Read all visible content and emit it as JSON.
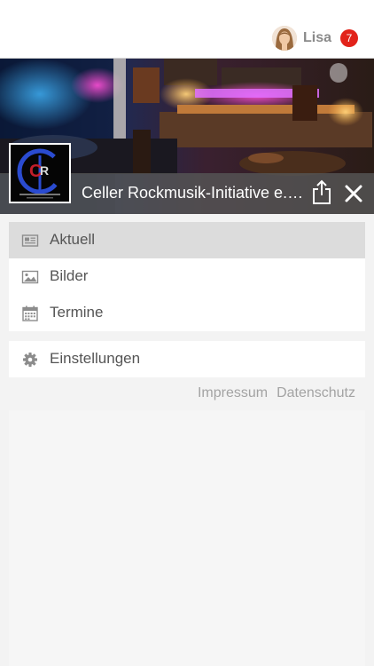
{
  "user": {
    "name": "Lisa",
    "notification_count": "7"
  },
  "header": {
    "title": "Celler Rockmusik-Initiative e.V...",
    "logo_letters": [
      "C",
      "R"
    ]
  },
  "menu": {
    "primary": [
      {
        "label": "Aktuell",
        "icon": "newspaper-icon",
        "active": true
      },
      {
        "label": "Bilder",
        "icon": "image-icon",
        "active": false
      },
      {
        "label": "Termine",
        "icon": "calendar-icon",
        "active": false
      }
    ],
    "secondary": [
      {
        "label": "Einstellungen",
        "icon": "gear-icon",
        "active": false
      }
    ]
  },
  "footer": {
    "impressum": "Impressum",
    "datenschutz": "Datenschutz"
  },
  "colors": {
    "badge": "#e2231a",
    "active_item": "#dcdcdc",
    "titlebar": "#555555",
    "background": "#f3f3f3"
  }
}
